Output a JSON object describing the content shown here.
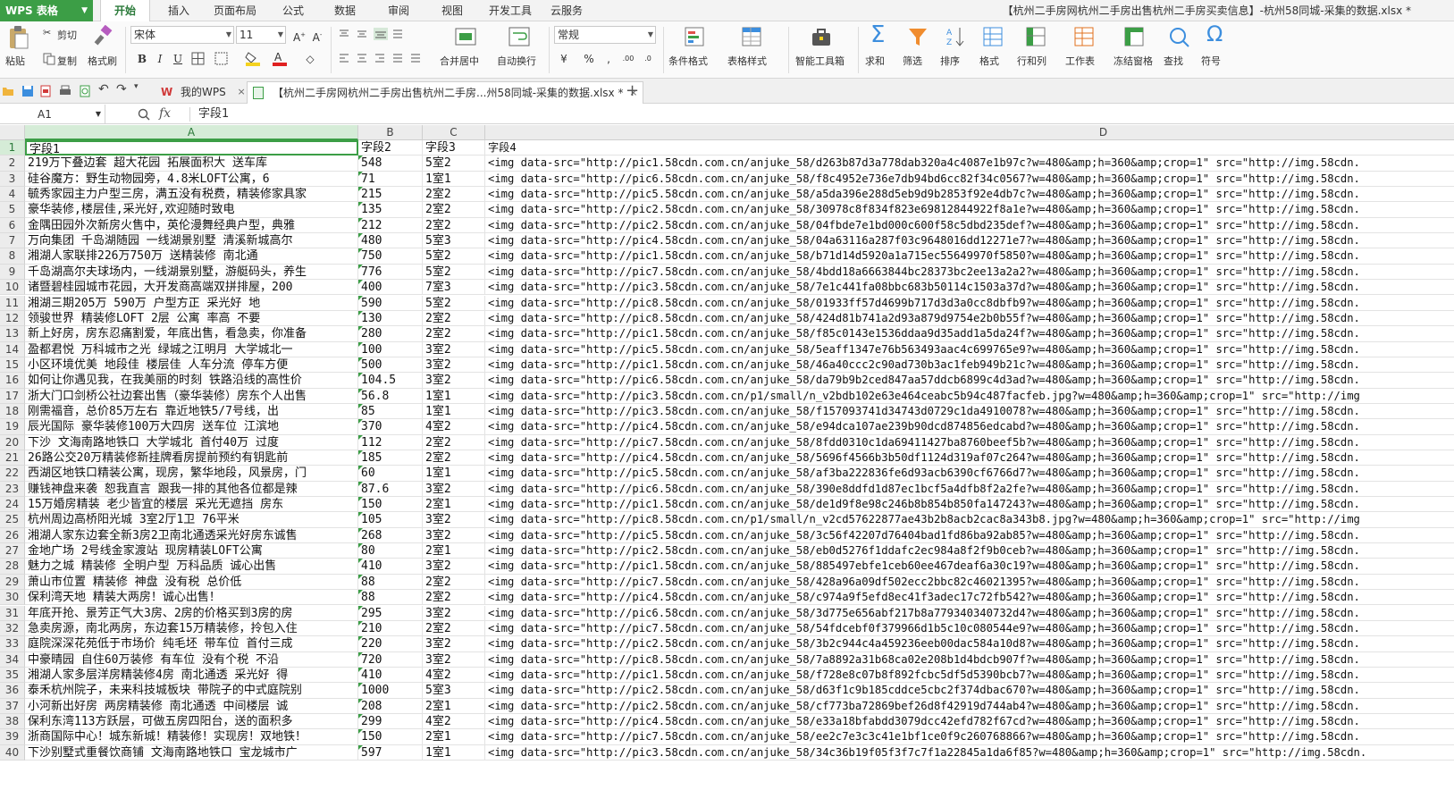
{
  "app": {
    "name": "WPS 表格",
    "document_title": "【杭州二手房网杭州二手房出售杭州二手房买卖信息】-杭州58同城-采集的数据.xlsx *"
  },
  "menu": {
    "tabs": [
      {
        "label": "开始",
        "active": true
      },
      {
        "label": "插入"
      },
      {
        "label": "页面布局"
      },
      {
        "label": "公式"
      },
      {
        "label": "数据"
      },
      {
        "label": "审阅"
      },
      {
        "label": "视图"
      },
      {
        "label": "开发工具"
      },
      {
        "label": "云服务"
      }
    ]
  },
  "ribbon": {
    "paste": "粘贴",
    "cut": "剪切",
    "copy": "复制",
    "format_painter": "格式刷",
    "font_name": "宋体",
    "font_size": "11",
    "merge_center": "合并居中",
    "wrap_text": "自动换行",
    "number_format": "常规",
    "conditional_format": "条件格式",
    "table_style": "表格样式",
    "smart_toolbox": "智能工具箱",
    "sum": "求和",
    "filter": "筛选",
    "sort": "排序",
    "format": "格式",
    "rows_cols": "行和列",
    "worksheet": "工作表",
    "freeze": "冻结窗格",
    "find": "查找",
    "symbol": "符号",
    "percent": "%",
    "bold": "B",
    "italic": "I",
    "underline": "U"
  },
  "colors": {
    "brand_green": "#3c9e46",
    "font_color_red": "#e02020",
    "fill_yellow": "#f4d21f"
  },
  "tabs": {
    "my_wps": "我的WPS",
    "active_doc": "【杭州二手房网杭州二手房出售杭州二手房...州58同城-采集的数据.xlsx *",
    "new_tab": "+"
  },
  "formula_bar": {
    "name_box": "A1",
    "fx_label": "fx",
    "value": "字段1"
  },
  "sheet": {
    "columns": [
      "A",
      "B",
      "C",
      "D"
    ],
    "header": [
      "字段1",
      "字段2",
      "字段3",
      "字段4"
    ],
    "rows": [
      [
        "219万下叠边套 超大花园 拓展面积大 送车库",
        "548",
        "5室2",
        "<img data-src=\"http://pic1.58cdn.com.cn/anjuke_58/d263b87d3a778dab320a4c4087e1b97c?w=480&amp;h=360&amp;crop=1\" src=\"http://img.58cdn."
      ],
      [
        "硅谷魔方：野生动物园旁，4.8米LOFT公寓，6",
        "71",
        "1室1",
        "<img data-src=\"http://pic6.58cdn.com.cn/anjuke_58/f8c4952e736e7db94bd6cc82f34c0567?w=480&amp;h=360&amp;crop=1\" src=\"http://img.58cdn."
      ],
      [
        "毓秀家园主力户型三房，满五没有税费，精装修家具家",
        "215",
        "2室2",
        "<img data-src=\"http://pic5.58cdn.com.cn/anjuke_58/a5da396e288d5eb9d9b2853f92e4db7c?w=480&amp;h=360&amp;crop=1\" src=\"http://img.58cdn."
      ],
      [
        "豪华装修,楼层佳,采光好,欢迎随时致电",
        "135",
        "2室2",
        "<img data-src=\"http://pic2.58cdn.com.cn/anjuke_58/30978c8f834f823e69812844922f8a1e?w=480&amp;h=360&amp;crop=1\" src=\"http://img.58cdn."
      ],
      [
        "金隅田园外次新房火售中，英伦漫舞经典户型，典雅",
        "212",
        "2室2",
        "<img data-src=\"http://pic2.58cdn.com.cn/anjuke_58/04fbde7e1bd000c600f58c5dbd235def?w=480&amp;h=360&amp;crop=1\" src=\"http://img.58cdn."
      ],
      [
        "万向集团 千岛湖随园 一线湖景别墅 清溪新城高尔",
        "480",
        "5室3",
        "<img data-src=\"http://pic4.58cdn.com.cn/anjuke_58/04a63116a287f03c9648016dd12271e7?w=480&amp;h=360&amp;crop=1\" src=\"http://img.58cdn."
      ],
      [
        "湘湖人家联排226万750万 送精装修 南北通",
        "750",
        "5室2",
        "<img data-src=\"http://pic1.58cdn.com.cn/anjuke_58/b71d14d5920a1a715ec55649970f5850?w=480&amp;h=360&amp;crop=1\" src=\"http://img.58cdn."
      ],
      [
        "千岛湖高尔夫球场内，一线湖景别墅，游艇码头，养生",
        "776",
        "5室2",
        "<img data-src=\"http://pic7.58cdn.com.cn/anjuke_58/4bdd18a6663844bc28373bc2ee13a2a2?w=480&amp;h=360&amp;crop=1\" src=\"http://img.58cdn."
      ],
      [
        "诸暨碧桂园城市花园，大开发商高端双拼排屋，200",
        "400",
        "7室3",
        "<img data-src=\"http://pic3.58cdn.com.cn/anjuke_58/7e1c441fa08bbc683b50114c1503a37d?w=480&amp;h=360&amp;crop=1\" src=\"http://img.58cdn."
      ],
      [
        "湘湖三期205万 590万 户型方正 采光好 地",
        "590",
        "5室2",
        "<img data-src=\"http://pic8.58cdn.com.cn/anjuke_58/01933ff57d4699b717d3d3a0cc8dbfb9?w=480&amp;h=360&amp;crop=1\" src=\"http://img.58cdn."
      ],
      [
        "领骏世界 精装修LOFT 2层 公寓 率高 不要",
        "130",
        "2室2",
        "<img data-src=\"http://pic8.58cdn.com.cn/anjuke_58/424d81b741a2d93a879d9754e2b0b55f?w=480&amp;h=360&amp;crop=1\" src=\"http://img.58cdn."
      ],
      [
        "新上好房，房东忍痛割爱，年底出售，看急卖，你准备",
        "280",
        "2室2",
        "<img data-src=\"http://pic1.58cdn.com.cn/anjuke_58/f85c0143e1536ddaa9d35add1a5da24f?w=480&amp;h=360&amp;crop=1\" src=\"http://img.58cdn."
      ],
      [
        "盈都君悦 万科城市之光 绿城之江明月 大学城北一",
        "100",
        "3室2",
        "<img data-src=\"http://pic5.58cdn.com.cn/anjuke_58/5eaff1347e76b563493aac4c699765e9?w=480&amp;h=360&amp;crop=1\" src=\"http://img.58cdn."
      ],
      [
        "小区环境优美 地段佳 楼层佳 人车分流 停车方便",
        "500",
        "3室2",
        "<img data-src=\"http://pic1.58cdn.com.cn/anjuke_58/46a40ccc2c90ad730b3ac1feb949b21c?w=480&amp;h=360&amp;crop=1\" src=\"http://img.58cdn."
      ],
      [
        "如何让你遇见我，在我美丽的时刻 铁路沿线的高性价",
        "104.5",
        "3室2",
        "<img data-src=\"http://pic6.58cdn.com.cn/anjuke_58/da79b9b2ced847aa57ddcb6899c4d3ad?w=480&amp;h=360&amp;crop=1\" src=\"http://img.58cdn."
      ],
      [
        "浙大门口剑桥公社边套出售（豪华装修）房东个人出售",
        "56.8",
        "1室1",
        "<img data-src=\"http://pic3.58cdn.com.cn/p1/small/n_v2bdb102e63e464ceabc5b94c487facfeb.jpg?w=480&amp;h=360&amp;crop=1\" src=\"http://img"
      ],
      [
        "刚需福音，总价85万左右 靠近地铁5/7号线，出",
        "85",
        "1室1",
        "<img data-src=\"http://pic3.58cdn.com.cn/anjuke_58/f157093741d34743d0729c1da4910078?w=480&amp;h=360&amp;crop=1\" src=\"http://img.58cdn."
      ],
      [
        "辰光国际 豪华装修100万大四房 送车位 江滨地",
        "370",
        "4室2",
        "<img data-src=\"http://pic4.58cdn.com.cn/anjuke_58/e94dca107ae239b90dcd874856edcabd?w=480&amp;h=360&amp;crop=1\" src=\"http://img.58cdn."
      ],
      [
        "下沙 文海南路地铁口 大学城北 首付40万 过度",
        "112",
        "2室2",
        "<img data-src=\"http://pic7.58cdn.com.cn/anjuke_58/8fdd0310c1da69411427ba8760beef5b?w=480&amp;h=360&amp;crop=1\" src=\"http://img.58cdn."
      ],
      [
        "26路公交20万精装修新挂牌看房提前预约有钥匙前",
        "185",
        "2室2",
        "<img data-src=\"http://pic4.58cdn.com.cn/anjuke_58/5696f4566b3b50df1124d319af07c264?w=480&amp;h=360&amp;crop=1\" src=\"http://img.58cdn."
      ],
      [
        "西湖区地铁口精装公寓，现房，繁华地段，风景房，门",
        "60",
        "1室1",
        "<img data-src=\"http://pic5.58cdn.com.cn/anjuke_58/af3ba222836fe6d93acb6390cf6766d7?w=480&amp;h=360&amp;crop=1\" src=\"http://img.58cdn."
      ],
      [
        "赚钱神盘来袭 恕我直言 跟我一排的其他各位都是辣",
        "87.6",
        "3室2",
        "<img data-src=\"http://pic6.58cdn.com.cn/anjuke_58/390e8ddfd1d87ec1bcf5a4dfb8f2a2fe?w=480&amp;h=360&amp;crop=1\" src=\"http://img.58cdn."
      ],
      [
        "15万婚房精装 老少皆宜的楼层 采光无遮挡 房东",
        "150",
        "2室1",
        "<img data-src=\"http://pic1.58cdn.com.cn/anjuke_58/de1d9f8e98c246b8b854b850fa147243?w=480&amp;h=360&amp;crop=1\" src=\"http://img.58cdn."
      ],
      [
        "杭州周边高桥阳光城 3室2厅1卫 76平米",
        "105",
        "3室2",
        "<img data-src=\"http://pic8.58cdn.com.cn/p1/small/n_v2cd57622877ae43b2b8acb2cac8a343b8.jpg?w=480&amp;h=360&amp;crop=1\" src=\"http://img"
      ],
      [
        "湘湖人家东边套全新3房2卫南北通透采光好房东诚售",
        "268",
        "3室2",
        "<img data-src=\"http://pic5.58cdn.com.cn/anjuke_58/3c56f42207d76404bad1fd86ba92ab85?w=480&amp;h=360&amp;crop=1\" src=\"http://img.58cdn."
      ],
      [
        "金地广场 2号线金家渡站 现房精装LOFT公寓",
        "80",
        "2室1",
        "<img data-src=\"http://pic2.58cdn.com.cn/anjuke_58/eb0d5276f1ddafc2ec984a8f2f9b0ceb?w=480&amp;h=360&amp;crop=1\" src=\"http://img.58cdn."
      ],
      [
        "魅力之城 精装修 全明户型 万科品质 诚心出售",
        "410",
        "3室2",
        "<img data-src=\"http://pic1.58cdn.com.cn/anjuke_58/885497ebfe1ceb60ee467deaf6a30c19?w=480&amp;h=360&amp;crop=1\" src=\"http://img.58cdn."
      ],
      [
        "萧山市位置 精装修 神盘  没有税 总价低",
        "88",
        "2室2",
        "<img data-src=\"http://pic7.58cdn.com.cn/anjuke_58/428a96a09df502ecc2bbc82c46021395?w=480&amp;h=360&amp;crop=1\" src=\"http://img.58cdn."
      ],
      [
        "保利湾天地 精装大两房！诚心出售！",
        "88",
        "2室2",
        "<img data-src=\"http://pic4.58cdn.com.cn/anjuke_58/c974a9f5efd8ec41f3adec17c72fb542?w=480&amp;h=360&amp;crop=1\" src=\"http://img.58cdn."
      ],
      [
        "年底开抢、景芳正气大3房、2房的价格买到3房的房",
        "295",
        "3室2",
        "<img data-src=\"http://pic6.58cdn.com.cn/anjuke_58/3d775e656abf217b8a779340340732d4?w=480&amp;h=360&amp;crop=1\" src=\"http://img.58cdn."
      ],
      [
        "急卖房源，南北两房，东边套15万精装修，拎包入住",
        "210",
        "2室2",
        "<img data-src=\"http://pic7.58cdn.com.cn/anjuke_58/54fdcebf0f379966d1b5c10c080544e9?w=480&amp;h=360&amp;crop=1\" src=\"http://img.58cdn."
      ],
      [
        "庭院深深花苑低于市场价 纯毛坯 带车位 首付三成",
        "220",
        "3室2",
        "<img data-src=\"http://pic2.58cdn.com.cn/anjuke_58/3b2c944c4a459236eeb00dac584a10d8?w=480&amp;h=360&amp;crop=1\" src=\"http://img.58cdn."
      ],
      [
        "中豪晴园 自住60万装修 有车位 没有个税 不沿",
        "720",
        "3室2",
        "<img data-src=\"http://pic8.58cdn.com.cn/anjuke_58/7a8892a31b68ca02e208b1d4bdcb907f?w=480&amp;h=360&amp;crop=1\" src=\"http://img.58cdn."
      ],
      [
        "湘湖人家多层洋房精装修4房 南北通透 采光好 得",
        "410",
        "4室2",
        "<img data-src=\"http://pic1.58cdn.com.cn/anjuke_58/f728e8c07b8f892fcbc5df5d5390bcb7?w=480&amp;h=360&amp;crop=1\" src=\"http://img.58cdn."
      ],
      [
        "泰禾杭州院子，未来科技城板块 带院子的中式庭院别",
        "1000",
        "5室3",
        "<img data-src=\"http://pic2.58cdn.com.cn/anjuke_58/d63f1c9b185cddce5cbc2f374dbac670?w=480&amp;h=360&amp;crop=1\" src=\"http://img.58cdn."
      ],
      [
        "小河新出好房 两房精装修 南北通透 中间楼层 诚",
        "208",
        "2室1",
        "<img data-src=\"http://pic2.58cdn.com.cn/anjuke_58/cf773ba72869bef26d8f42919d744ab4?w=480&amp;h=360&amp;crop=1\" src=\"http://img.58cdn."
      ],
      [
        "保利东湾113方跃层，可做五房四阳台，送的面积多",
        "299",
        "4室2",
        "<img data-src=\"http://pic4.58cdn.com.cn/anjuke_58/e33a18bfabdd3079dcc42efd782f67cd?w=480&amp;h=360&amp;crop=1\" src=\"http://img.58cdn."
      ],
      [
        "浙商国际中心！城东新城！精装修！实现房！双地铁！",
        "150",
        "2室1",
        "<img data-src=\"http://pic7.58cdn.com.cn/anjuke_58/ee2c7e3c3c41e1bf1ce0f9c260768866?w=480&amp;h=360&amp;crop=1\" src=\"http://img.58cdn."
      ],
      [
        "下沙别墅式重餐饮商铺 文海南路地铁口 宝龙城市广",
        "597",
        "1室1",
        "<img data-src=\"http://pic3.58cdn.com.cn/anjuke_58/34c36b19f05f3f7c7f1a22845a1da6f85?w=480&amp;h=360&amp;crop=1\" src=\"http://img.58cdn."
      ]
    ]
  }
}
